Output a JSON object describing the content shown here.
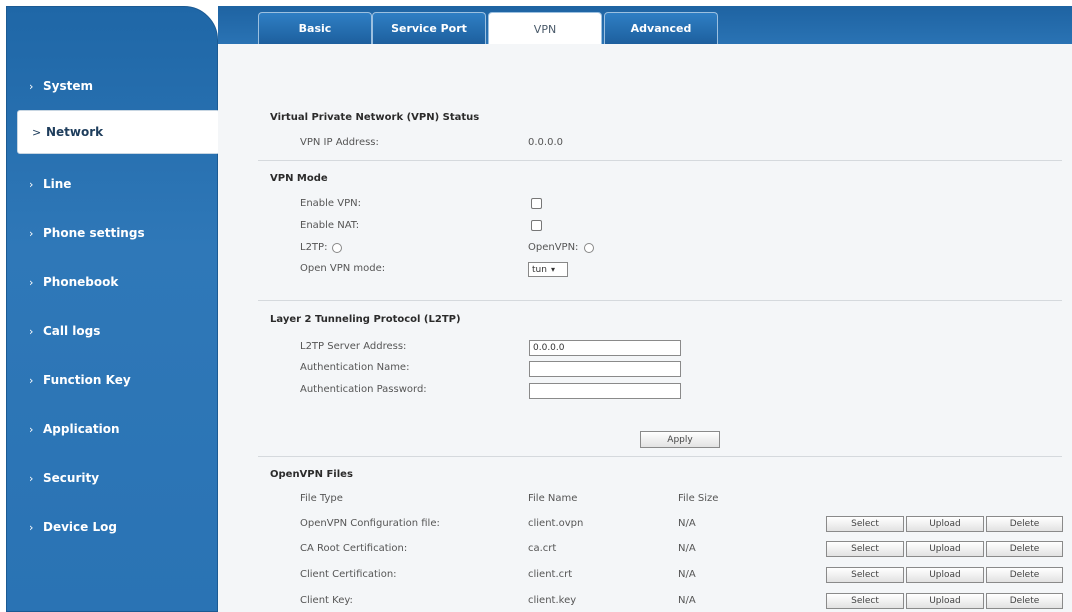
{
  "tabs": [
    {
      "label": "Basic"
    },
    {
      "label": "Service Port"
    },
    {
      "label": "VPN"
    },
    {
      "label": "Advanced"
    }
  ],
  "sidebar": {
    "items": [
      {
        "label": "System"
      },
      {
        "label": "Network"
      },
      {
        "label": "Line"
      },
      {
        "label": "Phone settings"
      },
      {
        "label": "Phonebook"
      },
      {
        "label": "Call logs"
      },
      {
        "label": "Function Key"
      },
      {
        "label": "Application"
      },
      {
        "label": "Security"
      },
      {
        "label": "Device Log"
      }
    ],
    "chevron": "›",
    "active_chevron": ">"
  },
  "vpn_status": {
    "title": "Virtual Private Network (VPN) Status",
    "ip_label": "VPN IP Address:",
    "ip_value": "0.0.0.0"
  },
  "vpn_mode": {
    "title": "VPN Mode",
    "enable_vpn_label": "Enable VPN:",
    "enable_nat_label": "Enable NAT:",
    "l2tp_label": "L2TP:",
    "openvpn_label": "OpenVPN:",
    "mode_label": "Open VPN mode:",
    "mode_value": "tun",
    "mode_arrow": "▾"
  },
  "l2tp": {
    "title": "Layer 2 Tunneling Protocol (L2TP)",
    "server_label": "L2TP Server Address:",
    "server_value": "0.0.0.0",
    "auth_name_label": "Authentication Name:",
    "auth_name_value": "",
    "auth_pass_label": "Authentication Password:",
    "auth_pass_value": "",
    "apply_label": "Apply"
  },
  "openvpn_files": {
    "title": "OpenVPN Files",
    "headers": [
      "File Type",
      "File Name",
      "File Size"
    ],
    "rows": [
      {
        "type": "OpenVPN Configuration file:",
        "name": "client.ovpn",
        "size": "N/A"
      },
      {
        "type": "CA Root Certification:",
        "name": "ca.crt",
        "size": "N/A"
      },
      {
        "type": "Client Certification:",
        "name": "client.crt",
        "size": "N/A"
      },
      {
        "type": "Client Key:",
        "name": "client.key",
        "size": "N/A"
      }
    ],
    "select_label": "Select",
    "upload_label": "Upload",
    "delete_label": "Delete"
  }
}
